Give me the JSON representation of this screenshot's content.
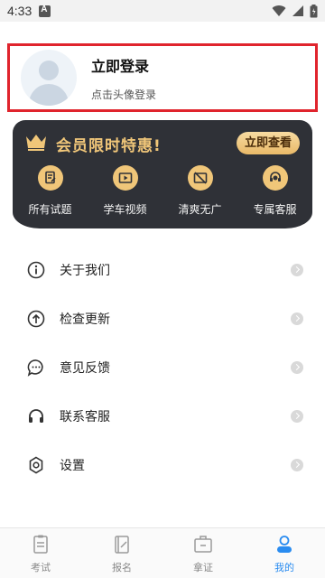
{
  "status_bar": {
    "time": "4:33"
  },
  "profile": {
    "title": "立即登录",
    "subtitle": "点击头像登录"
  },
  "vip": {
    "title": "会员限时特惠!",
    "button": "立即查看",
    "features": [
      {
        "label": "所有试题",
        "icon": "doc-edit-icon"
      },
      {
        "label": "学车视频",
        "icon": "video-icon"
      },
      {
        "label": "清爽无广",
        "icon": "no-ad-icon"
      },
      {
        "label": "专属客服",
        "icon": "customer-service-icon"
      }
    ],
    "accent": "#f0c679"
  },
  "menu": [
    {
      "label": "关于我们",
      "icon": "info-icon"
    },
    {
      "label": "检查更新",
      "icon": "upload-icon"
    },
    {
      "label": "意见反馈",
      "icon": "chat-bubble-icon"
    },
    {
      "label": "联系客服",
      "icon": "headset-icon"
    },
    {
      "label": "设置",
      "icon": "settings-icon"
    }
  ],
  "bottom_nav": {
    "items": [
      {
        "label": "考试",
        "icon": "exam-icon"
      },
      {
        "label": "报名",
        "icon": "signup-icon"
      },
      {
        "label": "拿证",
        "icon": "certificate-icon"
      },
      {
        "label": "我的",
        "icon": "profile-icon",
        "active": true
      }
    ],
    "active_color": "#2a8cf0"
  }
}
